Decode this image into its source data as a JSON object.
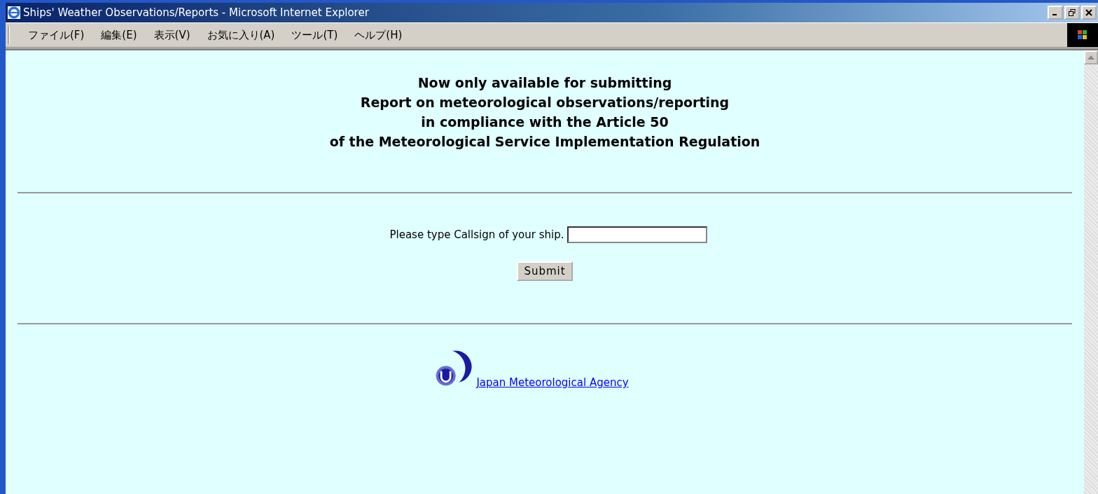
{
  "window": {
    "title": "Ships' Weather Observations/Reports - Microsoft Internet Explorer"
  },
  "menu": [
    "ファイル(F)",
    "編集(E)",
    "表示(V)",
    "お気に入り(A)",
    "ツール(T)",
    "ヘルプ(H)"
  ],
  "heading": [
    "Now only available for submitting",
    "Report on meteorological observations/reporting",
    "in compliance with the Article 50",
    "of the Meteorological Service Implementation Regulation"
  ],
  "form": {
    "label": "Please type Callsign of your ship.",
    "button": "Submit"
  },
  "footer": {
    "link": "Japan Meteorological Agency"
  }
}
